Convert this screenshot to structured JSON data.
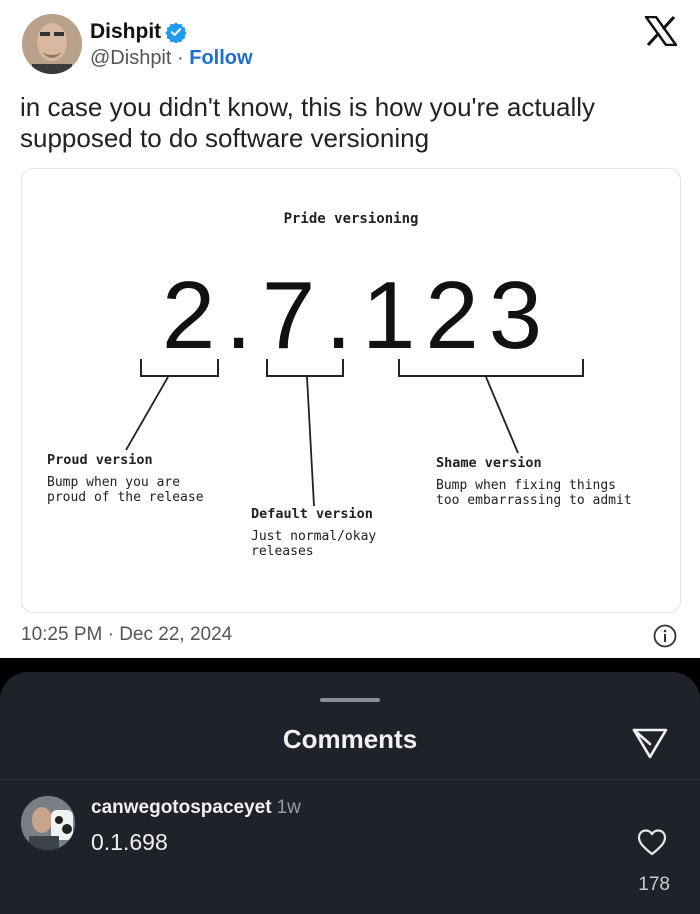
{
  "tweet": {
    "author": {
      "name": "Dishpit",
      "handle": "@Dishpit",
      "separator": "·",
      "follow_label": "Follow",
      "verified_icon": "verified-badge-icon",
      "verified_color": "#1d9bf0"
    },
    "platform_icon": "x-logo-icon",
    "text": "in case you didn't know, this is how you're actually supposed to do software versioning",
    "timestamp": "10:25 PM · Dec 22, 2024",
    "info_icon": "info-icon"
  },
  "diagram": {
    "title": "Pride versioning",
    "version_string": "2.7.123",
    "labels": [
      {
        "title": "Proud version",
        "desc_lines": [
          "Bump when you are",
          "proud of the release"
        ]
      },
      {
        "title": "Default version",
        "desc_lines": [
          "Just normal/okay",
          "releases"
        ]
      },
      {
        "title": "Shame version",
        "desc_lines": [
          "Bump when fixing things",
          "too embarrassing to admit"
        ]
      }
    ]
  },
  "comments_sheet": {
    "title": "Comments",
    "send_icon": "send-icon",
    "comment": {
      "username": "canwegotospaceyet",
      "time": "1w",
      "text": "0.1.698",
      "like_icon": "heart-icon",
      "likes": "178"
    }
  },
  "colors": {
    "sheet_background": "#1f2228",
    "follow_link": "#1d6fd6"
  }
}
